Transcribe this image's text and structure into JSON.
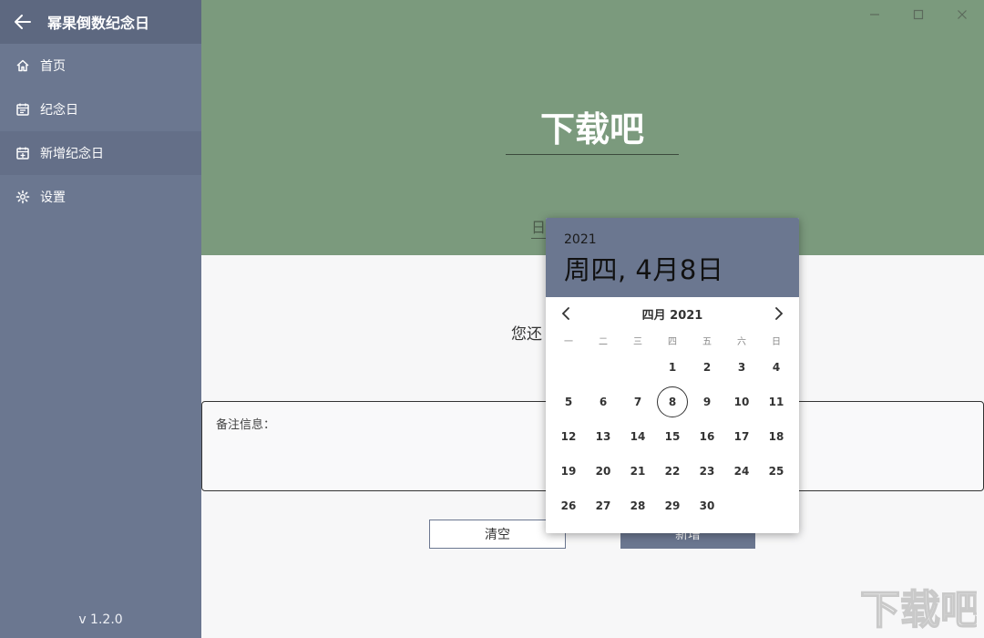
{
  "app": {
    "title": "幂果倒数纪念日",
    "version": "v 1.2.0"
  },
  "sidebar": {
    "items": [
      {
        "label": "首页",
        "icon": "home-icon"
      },
      {
        "label": "纪念日",
        "icon": "calendar-icon"
      },
      {
        "label": "新增纪念日",
        "icon": "calendar-add-icon"
      },
      {
        "label": "设置",
        "icon": "gear-icon"
      }
    ],
    "active_index": 2
  },
  "hero": {
    "name_value": "下载吧",
    "date_field_label": "日期"
  },
  "main": {
    "hint_text": "您还",
    "notes_label": "备注信息：",
    "clear_label": "清空",
    "add_label": "新增"
  },
  "picker": {
    "year": "2021",
    "date": "周四, 4月8日",
    "month_label": "四月 2021",
    "weekdays": [
      "一",
      "二",
      "三",
      "四",
      "五",
      "六",
      "日"
    ],
    "leading_blanks": 3,
    "days_in_month": 30,
    "selected_day": 8
  },
  "colors": {
    "sidebar": "#6b7790",
    "hero": "#7b9a7d",
    "accent": "#6b7790"
  },
  "watermark": {
    "text": "下载吧"
  }
}
